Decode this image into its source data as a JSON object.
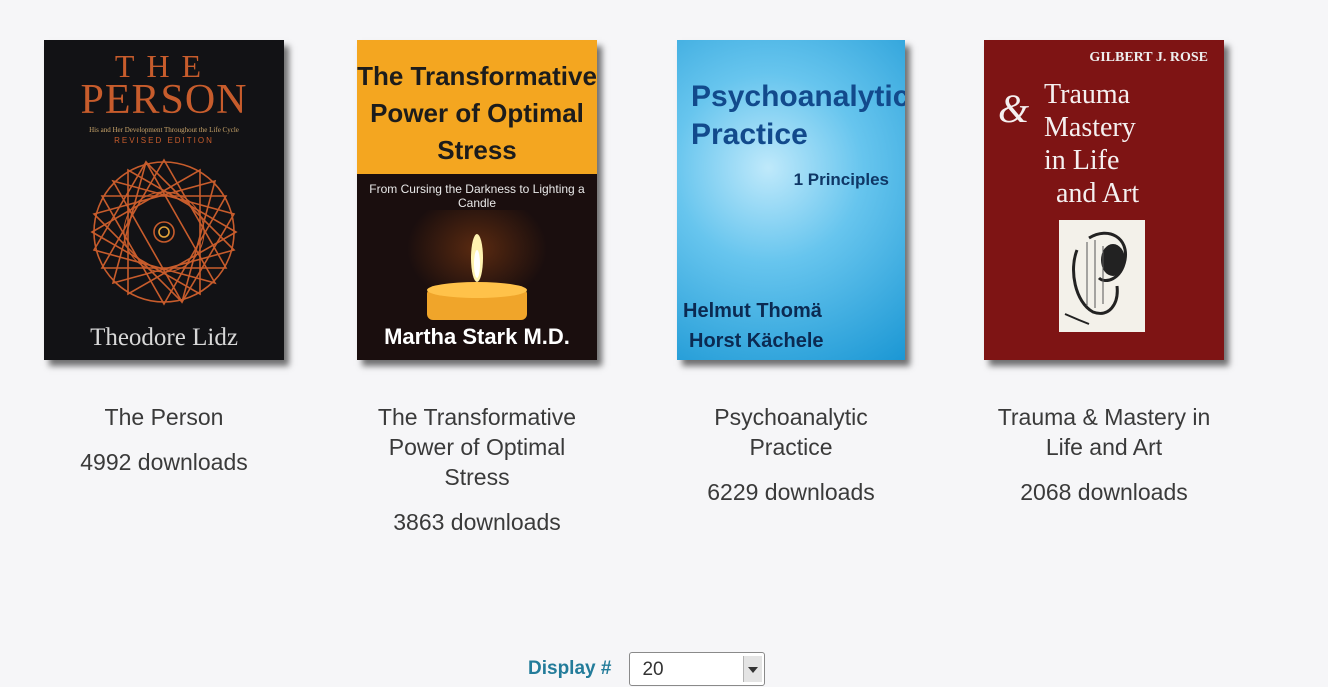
{
  "books": [
    {
      "title": "The Person",
      "downloads": "4992 downloads",
      "cover": {
        "line1": "THE",
        "line2": "PERSON",
        "tagline": "His and Her Development Throughout the Life Cycle",
        "edition": "REVISED EDITION",
        "author": "Theodore Lidz"
      }
    },
    {
      "title": "The Transformative Power of Optimal Stress",
      "downloads": "3863 downloads",
      "cover": {
        "title": "The Transformative Power of Optimal Stress",
        "subtitle": "From Cursing the Darkness to Lighting a Candle",
        "author": "Martha Stark M.D."
      }
    },
    {
      "title": "Psychoanalytic Practice",
      "downloads": "6229 downloads",
      "cover": {
        "title": "Psychoanalytic Practice",
        "volume": "1 Principles",
        "author1": "Helmut Thomä",
        "author2": "Horst Kächele"
      }
    },
    {
      "title": "Trauma & Mastery in Life and Art",
      "downloads": "2068 downloads",
      "cover": {
        "author": "GILBERT J. ROSE",
        "amp": "&",
        "line1": "Trauma",
        "line2": "Mastery",
        "line3": "in Life",
        "line4": "and Art"
      }
    }
  ],
  "display": {
    "label": "Display #",
    "value": "20"
  },
  "colors": {
    "background": "#f6f6f8",
    "label_accent": "#237c9a"
  }
}
